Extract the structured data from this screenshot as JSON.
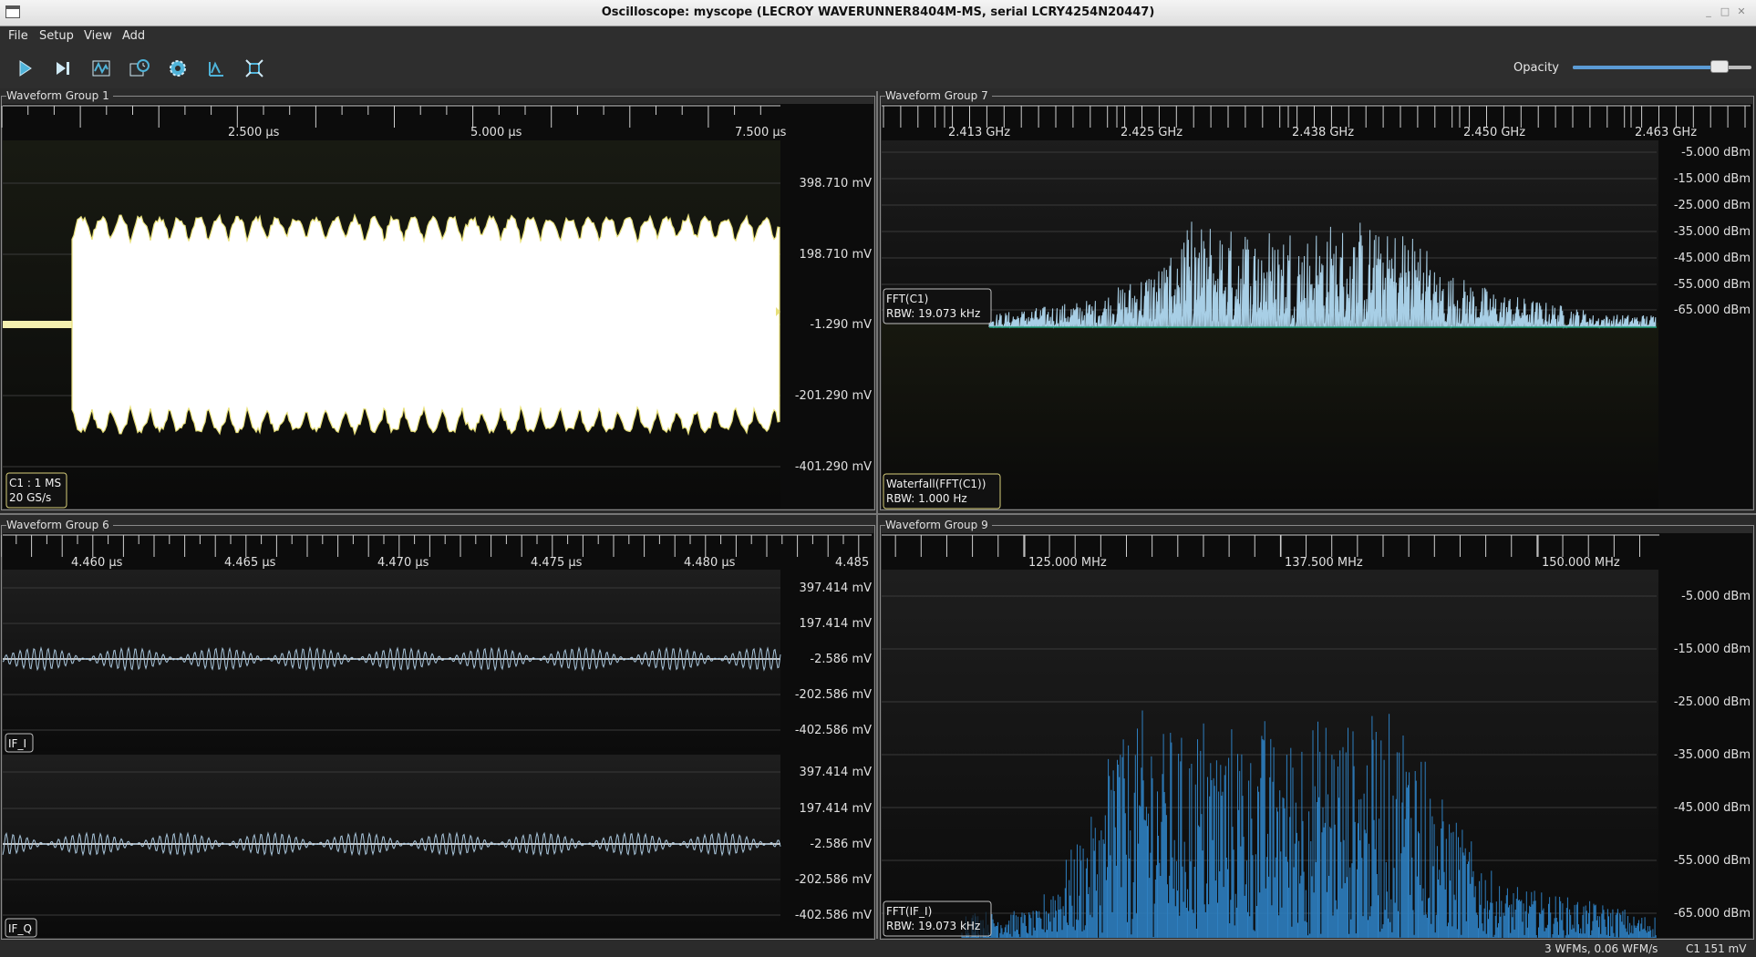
{
  "window": {
    "title": "Oscilloscope: myscope (LECROY WAVERUNNER8404M-MS, serial LCRY4254N20447)"
  },
  "menu": [
    "File",
    "Setup",
    "View",
    "Add"
  ],
  "toolbar": {
    "buttons": [
      "start-trigger-icon",
      "single-trigger-icon",
      "fft-icon",
      "history-icon",
      "settings-gear-icon",
      "measure-icon",
      "fullscreen-icon"
    ],
    "opacity_label": "Opacity",
    "opacity_value": 0.82
  },
  "groups": {
    "g1": {
      "title": "Waveform Group 1",
      "xticks": [
        "2.500 µs",
        "5.000 µs",
        "7.500 µs"
      ],
      "yticks": [
        "398.710 mV",
        "198.710 mV",
        "-1.290 mV",
        "-201.290 mV",
        "-401.290 mV"
      ],
      "label_line1": "C1 : 1 MS",
      "label_line2": "20 GS/s"
    },
    "g7": {
      "title": "Waveform Group 7",
      "xticks": [
        "2.413 GHz",
        "2.425 GHz",
        "2.438 GHz",
        "2.450 GHz",
        "2.463 GHz"
      ],
      "yticks": [
        "-5.000 dBm",
        "-15.000 dBm",
        "-25.000 dBm",
        "-35.000 dBm",
        "-45.000 dBm",
        "-55.000 dBm",
        "-65.000 dBm"
      ],
      "fft_label1": "FFT(C1)",
      "fft_label2": "RBW: 19.073 kHz",
      "wf_label1": "Waterfall(FFT(C1))",
      "wf_label2": "RBW: 1.000 Hz"
    },
    "g6": {
      "title": "Waveform Group 6",
      "xticks": [
        "4.460 µs",
        "4.465 µs",
        "4.470 µs",
        "4.475 µs",
        "4.480 µs",
        "4.485"
      ],
      "yticks": [
        "397.414 mV",
        "197.414 mV",
        "-2.586 mV",
        "-202.586 mV",
        "-402.586 mV"
      ],
      "label_i": "IF_I",
      "label_q": "IF_Q"
    },
    "g9": {
      "title": "Waveform Group 9",
      "xticks": [
        "125.000 MHz",
        "137.500 MHz",
        "150.000 MHz"
      ],
      "yticks": [
        "-5.000 dBm",
        "-15.000 dBm",
        "-25.000 dBm",
        "-35.000 dBm",
        "-45.000 dBm",
        "-55.000 dBm",
        "-65.000 dBm"
      ],
      "label1": "FFT(IF_I)",
      "label2": "RBW: 19.073 kHz"
    }
  },
  "status": {
    "wfms": "3 WFMs, 0.06 WFM/s",
    "cursor": "C1 151 mV"
  },
  "colors": {
    "c1_trace": "#ffffff",
    "c1_edge": "#e8e07a",
    "fft_c1": "#a8cfe6",
    "fft_if": "#2e7fc0",
    "baseline": "#1fa07a",
    "if_trace": "#a9c6dc"
  }
}
